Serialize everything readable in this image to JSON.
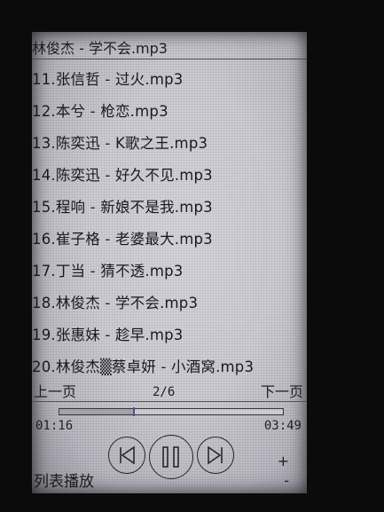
{
  "now_playing": "林俊杰 - 学不会.mp3",
  "playlist": [
    "11.张信哲 - 过火.mp3",
    "12.本兮 - 枪恋.mp3",
    "13.陈奕迅 - K歌之王.mp3",
    "14.陈奕迅 - 好久不见.mp3",
    "15.程响 - 新娘不是我.mp3",
    "16.崔子格 - 老婆最大.mp3",
    "17.丁当 - 猜不透.mp3",
    "18.林俊杰 - 学不会.mp3",
    "19.张惠妹 - 趁早.mp3",
    "20.林俊杰▒蔡卓妍 - 小酒窝.mp3"
  ],
  "pager": {
    "prev_label": "上一页",
    "page_indicator": "2/6",
    "next_label": "下一页"
  },
  "playback": {
    "elapsed": "01:16",
    "total": "03:49",
    "progress_fraction": 0.332
  },
  "controls": {
    "prev_icon": "skip-previous-icon",
    "pause_icon": "pause-icon",
    "next_icon": "skip-next-icon",
    "volume_up": "+",
    "volume_down": "-"
  },
  "mode_label": "列表播放"
}
